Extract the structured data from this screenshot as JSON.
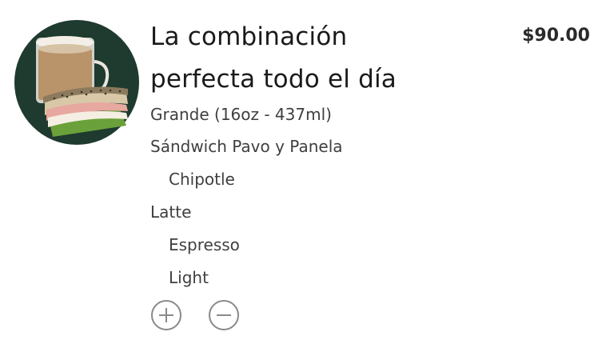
{
  "product": {
    "title_line1": "La combinación",
    "title_line2": "perfecta todo el día",
    "price": "$90.00",
    "image_icon": "coffee-and-sandwich-image"
  },
  "options": {
    "size": "Grande (16oz - 437ml)",
    "sandwich": "Sándwich Pavo y Panela",
    "sandwich_sauce": "Chipotle",
    "drink": "Latte",
    "drink_shot": "Espresso",
    "drink_milk": "Light"
  },
  "quantity_controls": {
    "increase_icon": "plus-circle-icon",
    "decrease_icon": "minus-circle-icon"
  },
  "colors": {
    "image_background": "#1f3a2e",
    "icon_stroke": "#8a8a8a",
    "text": "#3f3f3f"
  }
}
